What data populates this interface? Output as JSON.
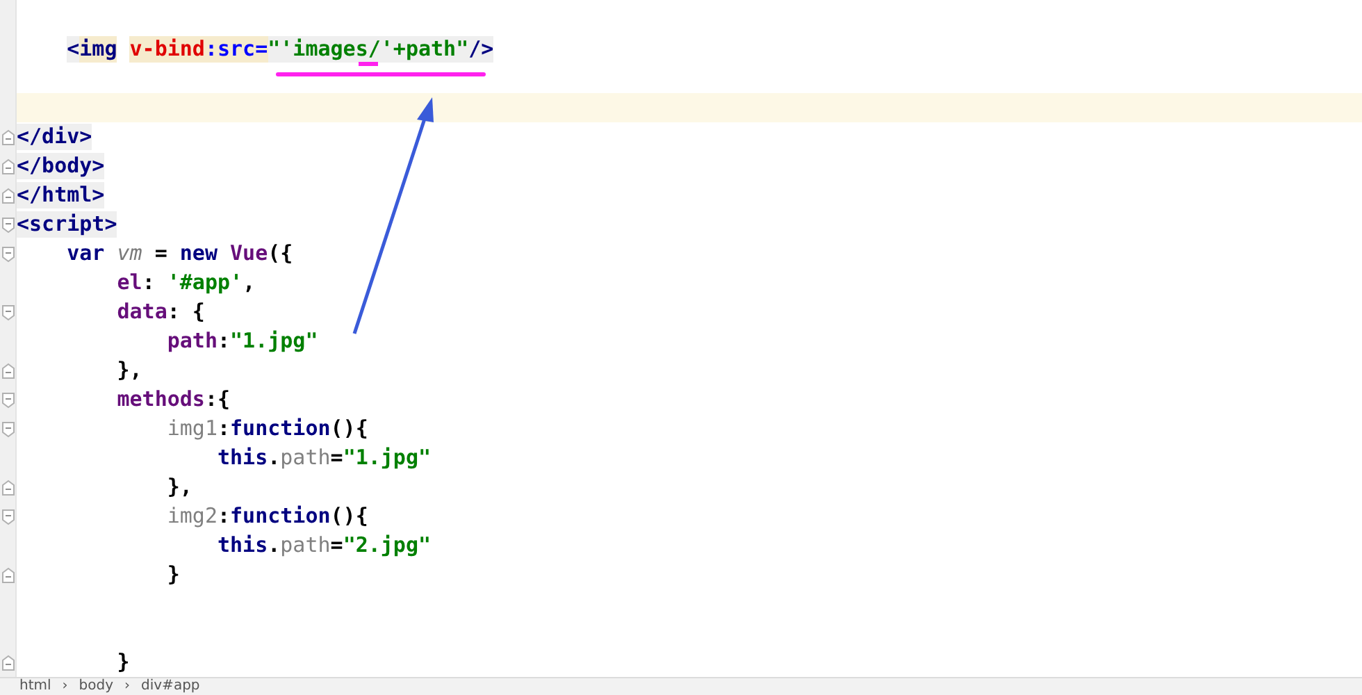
{
  "editor": {
    "lines": [
      {
        "current": false
      },
      {
        "current": false,
        "tokens": [
          {
            "text": "    <",
            "kind": "tag"
          },
          {
            "text": "img",
            "kind": "tagname_hl"
          },
          {
            "text": " v-bind",
            "kind": "directive"
          },
          {
            "text": ":src=",
            "kind": "attr_hl"
          },
          {
            "text": "\"'images/'+path\"",
            "kind": "string_tag"
          },
          {
            "text": "/>",
            "kind": "tag"
          }
        ]
      },
      {
        "current": false
      },
      {
        "current": true
      },
      {
        "current": false,
        "fold_marker": true,
        "closing": true,
        "tokens": [
          {
            "text": "</div>",
            "kind": "tag"
          }
        ]
      },
      {
        "current": false,
        "fold_marker": true,
        "closing": true,
        "tokens": [
          {
            "text": "</body>",
            "kind": "tag"
          }
        ]
      },
      {
        "current": false,
        "fold_marker": true,
        "closing": true,
        "tokens": [
          {
            "text": "</html>",
            "kind": "tag"
          }
        ]
      },
      {
        "current": false,
        "fold_marker": true,
        "closing": false,
        "tokens": [
          {
            "text": "<script>",
            "kind": "tag"
          }
        ]
      },
      {
        "current": false,
        "fold_marker": true,
        "closing": false,
        "tokens": [
          {
            "text": "    var ",
            "kind": "keyword"
          },
          {
            "text": "vm",
            "kind": "ident"
          },
          {
            "text": " = ",
            "kind": "plain"
          },
          {
            "text": "new ",
            "kind": "keyword"
          },
          {
            "text": "Vue",
            "kind": "prop"
          },
          {
            "text": "({",
            "kind": "plain"
          }
        ]
      },
      {
        "current": false,
        "tokens": [
          {
            "text": "        el",
            "kind": "prop"
          },
          {
            "text": ": ",
            "kind": "plain"
          },
          {
            "text": "'#app'",
            "kind": "string"
          },
          {
            "text": ",",
            "kind": "plain"
          }
        ]
      },
      {
        "current": false,
        "fold_marker": true,
        "closing": false,
        "tokens": [
          {
            "text": "        data",
            "kind": "prop"
          },
          {
            "text": ": {",
            "kind": "plain"
          }
        ]
      },
      {
        "current": false,
        "tokens": [
          {
            "text": "            path",
            "kind": "prop"
          },
          {
            "text": ":",
            "kind": "plain"
          },
          {
            "text": "\"1.jpg\"",
            "kind": "string"
          }
        ]
      },
      {
        "current": false,
        "fold_marker": true,
        "closing": true,
        "tokens": [
          {
            "text": "        },",
            "kind": "plain"
          }
        ]
      },
      {
        "current": false,
        "fold_marker": true,
        "closing": false,
        "tokens": [
          {
            "text": "        methods",
            "kind": "prop"
          },
          {
            "text": ":{",
            "kind": "plain"
          }
        ]
      },
      {
        "current": false,
        "fold_marker": true,
        "closing": false,
        "tokens": [
          {
            "text": "            img1",
            "kind": "method"
          },
          {
            "text": ":",
            "kind": "plain"
          },
          {
            "text": "function",
            "kind": "keyword"
          },
          {
            "text": "(){",
            "kind": "plain"
          }
        ]
      },
      {
        "current": false,
        "tokens": [
          {
            "text": "                this",
            "kind": "keyword"
          },
          {
            "text": ".",
            "kind": "plain"
          },
          {
            "text": "path",
            "kind": "method"
          },
          {
            "text": "=",
            "kind": "plain"
          },
          {
            "text": "\"1.jpg\"",
            "kind": "string"
          }
        ]
      },
      {
        "current": false,
        "fold_marker": true,
        "closing": true,
        "tokens": [
          {
            "text": "            },",
            "kind": "plain"
          }
        ]
      },
      {
        "current": false,
        "fold_marker": true,
        "closing": false,
        "tokens": [
          {
            "text": "            img2",
            "kind": "method"
          },
          {
            "text": ":",
            "kind": "plain"
          },
          {
            "text": "function",
            "kind": "keyword"
          },
          {
            "text": "(){",
            "kind": "plain"
          }
        ]
      },
      {
        "current": false,
        "tokens": [
          {
            "text": "                this",
            "kind": "keyword"
          },
          {
            "text": ".",
            "kind": "plain"
          },
          {
            "text": "path",
            "kind": "method"
          },
          {
            "text": "=",
            "kind": "plain"
          },
          {
            "text": "\"2.jpg\"",
            "kind": "string"
          }
        ]
      },
      {
        "current": false,
        "fold_marker": true,
        "closing": true,
        "tokens": [
          {
            "text": "            }",
            "kind": "plain"
          }
        ]
      },
      {
        "current": false
      },
      {
        "current": false
      },
      {
        "current": false,
        "fold_marker": true,
        "closing": true,
        "tokens": [
          {
            "text": "        }",
            "kind": "plain"
          }
        ]
      }
    ]
  },
  "breadcrumb": {
    "separator": "›",
    "items": [
      "html",
      "body",
      "div#app"
    ]
  }
}
